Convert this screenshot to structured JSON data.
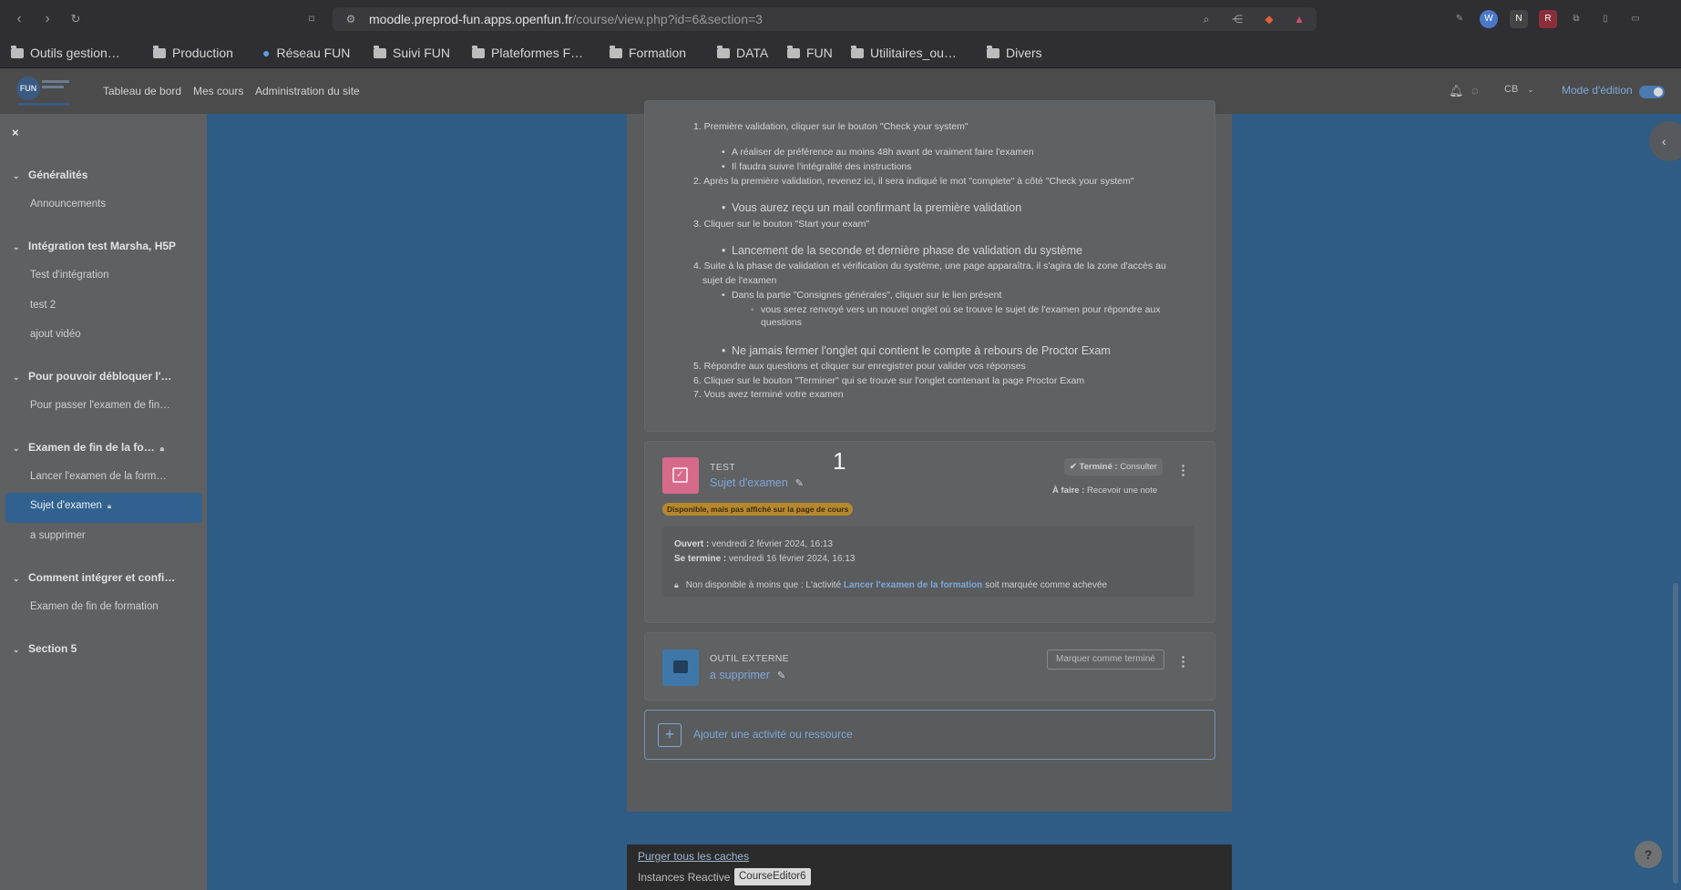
{
  "browser": {
    "url_host": "moodle.preprod-fun.apps.openfun.fr",
    "url_path": "/course/view.php?id=6&section=3",
    "bookmarks": [
      "Outils gestion…",
      "Production",
      "Réseau FUN",
      "Suivi FUN",
      "Plateformes F…",
      "Formation",
      "DATA",
      "FUN",
      "Utilitaires_ou…",
      "Divers"
    ]
  },
  "header": {
    "logo_text": "FUN",
    "nav": [
      "Tableau de bord",
      "Mes cours",
      "Administration du site"
    ],
    "user_initials": "CB",
    "edit_mode_label": "Mode d'édition"
  },
  "sidebar": {
    "close": "×",
    "sections": [
      {
        "title": "Généralités",
        "items": [
          "Announcements"
        ]
      },
      {
        "title": "Intégration test Marsha, H5P",
        "items": [
          "Test d'intégration",
          "test 2",
          "ajout vidéo"
        ]
      },
      {
        "title": "Pour pouvoir débloquer l'…",
        "items": [
          "Pour passer l'examen de fin…"
        ]
      },
      {
        "title": "Examen de fin de la fo…",
        "items": [
          "Lancer l'examen de la form…",
          "Sujet d'examen",
          "a supprimer"
        ]
      },
      {
        "title": "Comment intégrer et confi…",
        "items": [
          "Examen de fin de formation"
        ]
      },
      {
        "title": "Section 5",
        "items": []
      }
    ]
  },
  "instructions": {
    "l1": "1. Première validation, cliquer sur le bouton \"Check your system\"",
    "l1a": "A réaliser de préférence au moins 48h avant de vraiment faire l'examen",
    "l1b": "Il faudra suivre l'intégralité des instructions",
    "l2": "2. Après la première validation, revenez ici, il sera indiqué le mot \"complete\" à côté \"Check your system\"",
    "l2a": "Vous aurez reçu un mail confirmant la première validation",
    "l3": "3. Cliquer sur le bouton \"Start your exam\"",
    "l3a": "Lancement de la seconde et dernière phase de validation du système",
    "l4": "4. Suite à la phase de validation et vérification du système, une page apparaîtra, il s'agira de la zone d'accès au",
    "l4cont": "sujet de l'examen",
    "l4a": "Dans la partie \"Consignes générales\", cliquer sur le lien présent",
    "l4b1": "vous serez renvoyé vers un nouvel onglet où se trouve le sujet de l'examen pour répondre aux",
    "l4b2": "questions",
    "l4c": "Ne jamais fermer l'onglet qui contient le compte à rebours de Proctor Exam",
    "l5": "5. Répondre aux questions et cliquer sur enregistrer pour valider vos réponses",
    "l6": "6. Cliquer sur le bouton \"Terminer\" qui se trouve sur l'onglet contenant la page Proctor Exam",
    "l7": "7. Vous avez terminé votre examen"
  },
  "activity_test": {
    "type": "TEST",
    "name": "Sujet d'examen",
    "done_label": "Terminé :",
    "done_action": "Consulter",
    "todo_label": "À faire :",
    "todo_text": "Recevoir une note",
    "visibility_badge": "Disponible, mais pas affiché sur la page de cours",
    "opened_label": "Ouvert :",
    "opened_value": "vendredi 2 février 2024, 16:13",
    "closes_label": "Se termine :",
    "closes_value": "vendredi 16 février 2024, 16:13",
    "restriction_prefix": "Non disponible à moins que : L'activité",
    "restriction_link": "Lancer l'examen de la formation",
    "restriction_suffix": "soit marquée comme achevée"
  },
  "activity_external": {
    "type": "OUTIL EXTERNE",
    "name": "a supprimer",
    "mark_done": "Marquer comme terminé"
  },
  "add_activity": "Ajouter une activité ou ressource",
  "footer": {
    "purge": "Purger tous les caches",
    "reactive_label": "Instances Reactive",
    "reactive_tag": "CourseEditor6"
  },
  "help": "?",
  "marker": "1",
  "colors": {
    "accent": "#7fa8d8",
    "active_item": "#31628f",
    "test_icon": "#d66a8a",
    "warning_badge": "#b5882e"
  }
}
